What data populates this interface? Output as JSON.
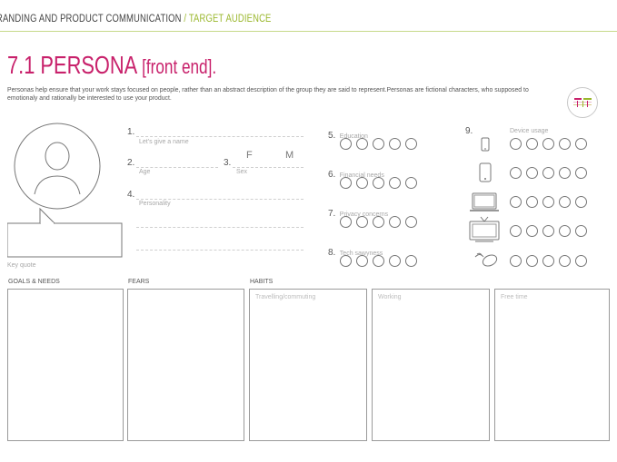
{
  "header": {
    "breadcrumb_main": "RANDING AND PRODUCT COMMUNICATION",
    "breadcrumb_sep": "/",
    "breadcrumb_section": "TARGET AUDIENCE"
  },
  "title": {
    "main": "7.1 PERSONA",
    "sub": "[front end]."
  },
  "intro": "Personas help ensure that your work stays focused on people, rather than an abstract description of the group they are said to represent.Personas are fictional characters, who supposed to emotionaly and rationally be interested to use your product.",
  "persona": {
    "key_quote_label": "Key quote",
    "fields": {
      "name_num": "1.",
      "name_label": "Let's give a name",
      "age_num": "2.",
      "age_label": "Age",
      "sex_num": "3.",
      "sex_label": "Sex",
      "sex_f": "F",
      "sex_m": "M",
      "personality_num": "4.",
      "personality_label": "Personality"
    }
  },
  "ratings": [
    {
      "num": "5.",
      "label": "Education"
    },
    {
      "num": "6.",
      "label": "Financial needs"
    },
    {
      "num": "7.",
      "label": "Privacy concerns"
    },
    {
      "num": "8.",
      "label": "Tech sawyness"
    }
  ],
  "devices": {
    "num": "9.",
    "label": "Device usage",
    "items": [
      "phone-small-icon",
      "smartphone-icon",
      "laptop-icon",
      "tv-icon",
      "mouse-icon"
    ]
  },
  "sections": {
    "goals": "GOALS & NEEDS",
    "fears": "FEARS",
    "habits": "HABITS",
    "habit_travel": "Travelling/commuting",
    "habit_working": "Working",
    "habit_free": "Free time"
  },
  "colors": {
    "title": "#c8216b",
    "accent": "#9ab72c"
  }
}
